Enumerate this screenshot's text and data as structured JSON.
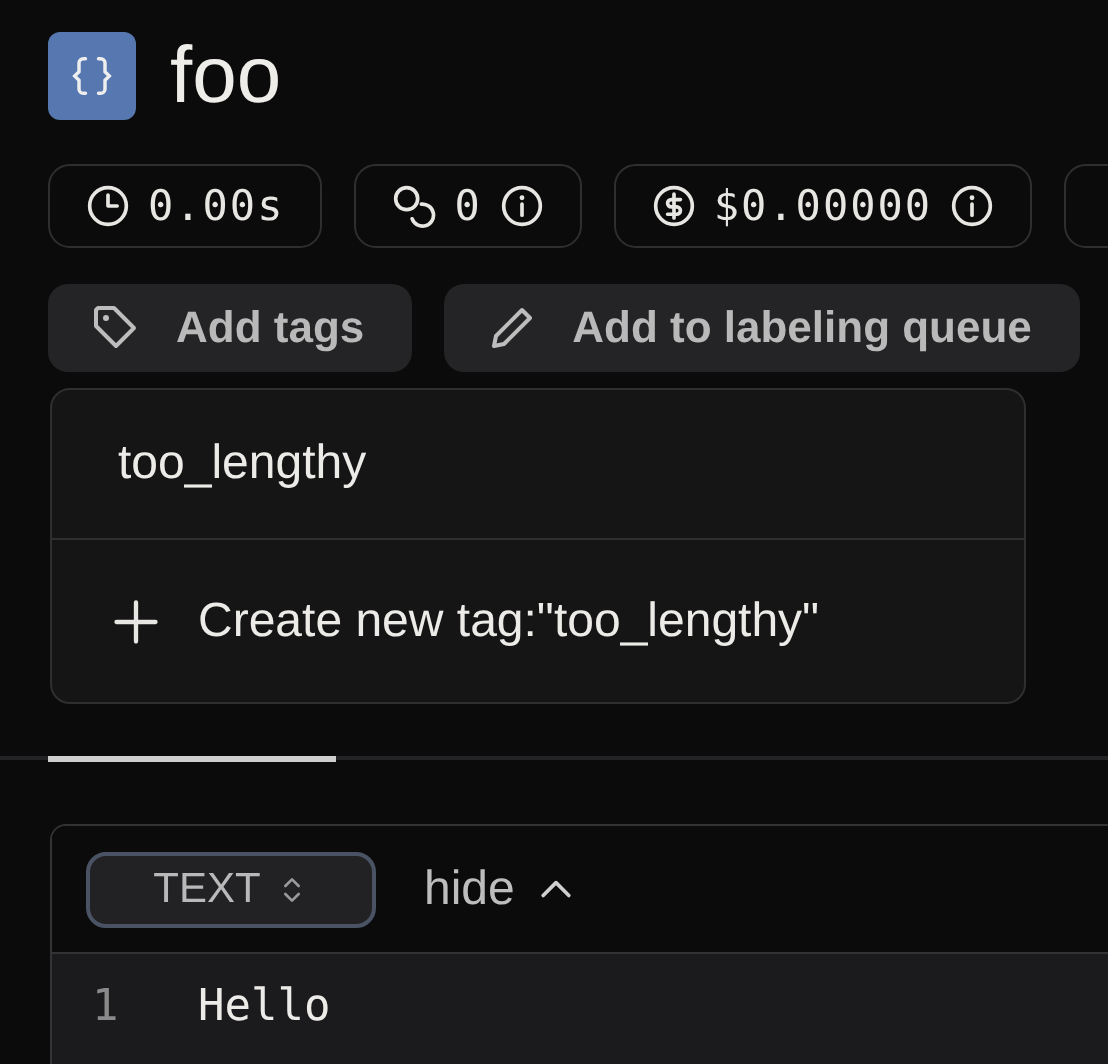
{
  "title": "foo",
  "stats": [
    {
      "kind": "time",
      "value": "0.00s",
      "info": false
    },
    {
      "kind": "tokens",
      "value": "0",
      "info": true
    },
    {
      "kind": "cost",
      "value": "$0.00000",
      "info": true
    },
    {
      "kind": "cut"
    }
  ],
  "actions": [
    {
      "kind": "tag",
      "label": "Add tags"
    },
    {
      "kind": "pencil",
      "label": "Add to labeling queue"
    }
  ],
  "dropdown": {
    "items": [
      {
        "kind": "option",
        "label": "too_lengthy"
      },
      {
        "kind": "create",
        "label": "Create new tag:\"too_lengthy\""
      }
    ]
  },
  "editor": {
    "format": "TEXT",
    "toggle": "hide",
    "lines": [
      {
        "number": "1",
        "text": "Hello"
      }
    ]
  }
}
